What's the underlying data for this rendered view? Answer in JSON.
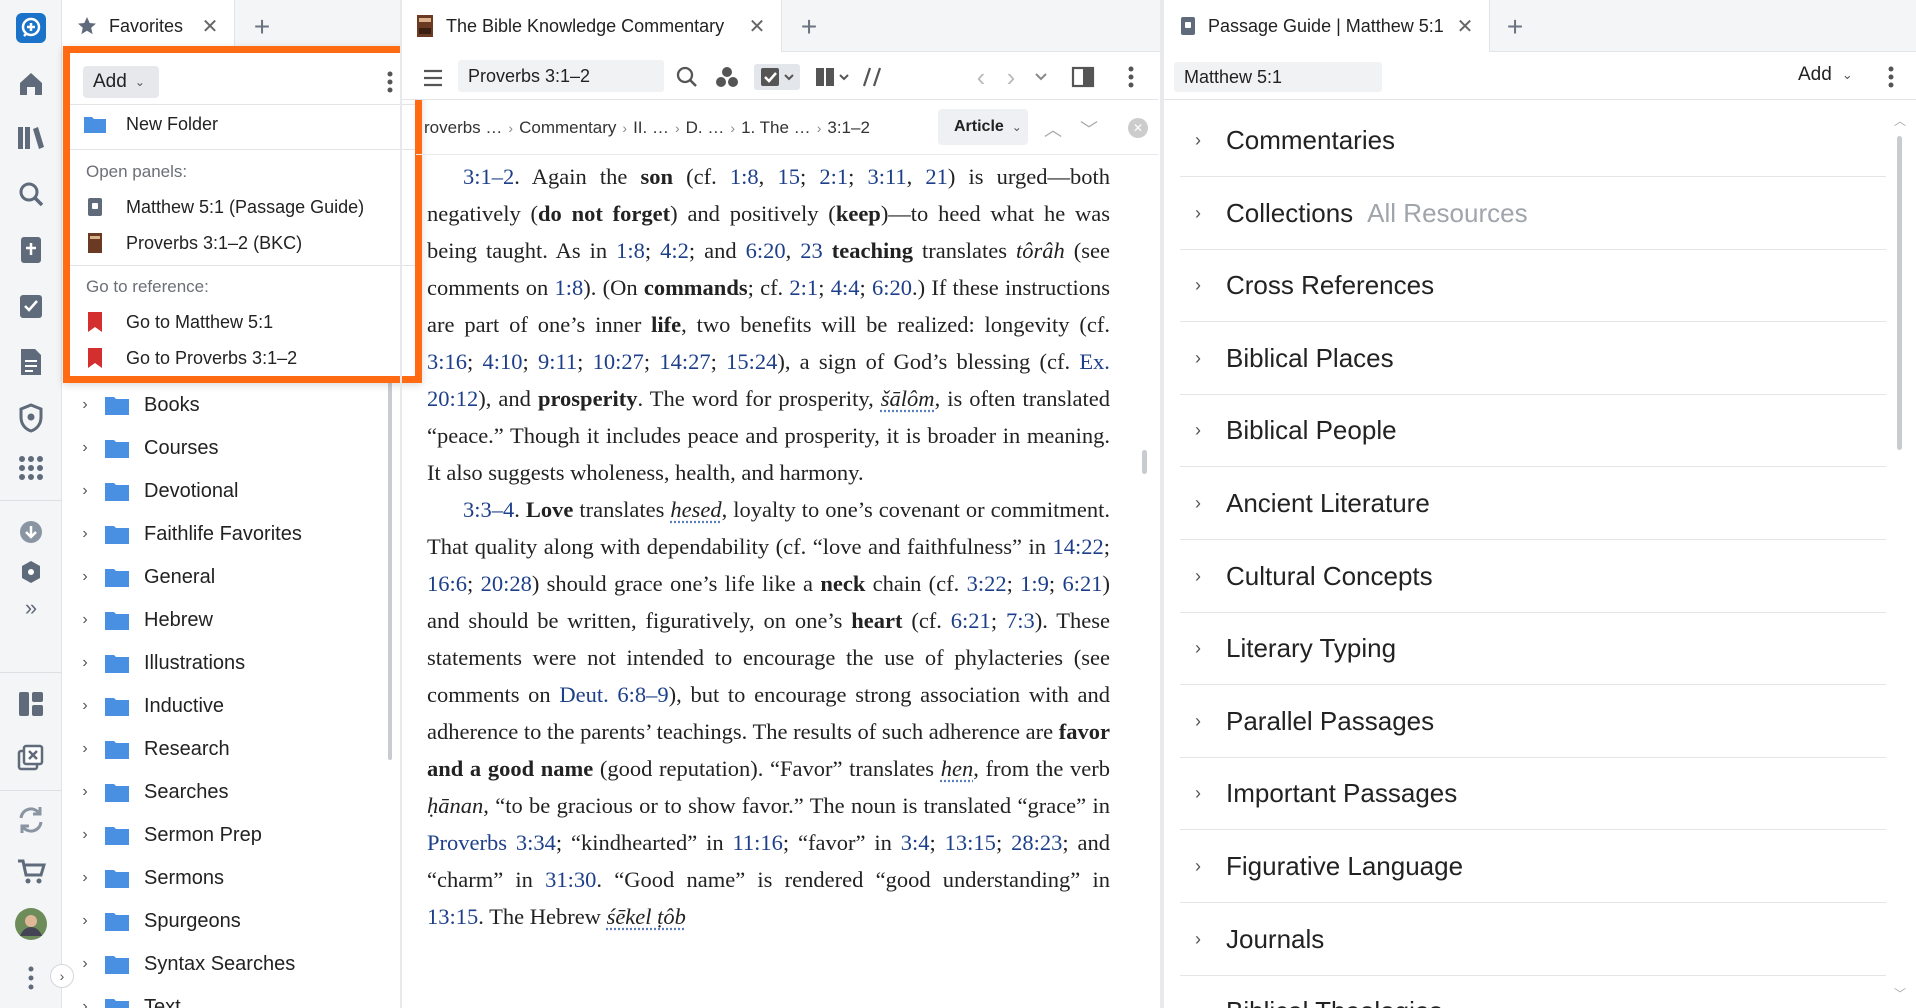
{
  "colors": {
    "accent": "#ff6a13",
    "link": "#1d3f8a",
    "folder": "#4a90e2",
    "brand": "#1a73c8"
  },
  "rail": {
    "icons": [
      "logos-add-icon",
      "home-icon",
      "library-icon",
      "search-icon",
      "guides-icon",
      "reading-plan-icon",
      "documents-icon",
      "shield-icon",
      "apps-icon",
      "download-icon",
      "factbook-icon",
      "expand-icon",
      "layouts-icon",
      "close-panels-icon",
      "sync-icon",
      "cart-icon",
      "avatar",
      "more-icon"
    ]
  },
  "favorites": {
    "tab_title": "Favorites",
    "folders": [
      "Books",
      "Courses",
      "Devotional",
      "Faithlife Favorites",
      "General",
      "Hebrew",
      "Illustrations",
      "Inductive",
      "Research",
      "Searches",
      "Sermon Prep",
      "Sermons",
      "Spurgeons",
      "Syntax Searches",
      "Text"
    ]
  },
  "popup": {
    "add_label": "Add",
    "new_folder": "New Folder",
    "open_panels_label": "Open panels:",
    "open_panels": [
      "Matthew 5:1 (Passage Guide)",
      "Proverbs 3:1–2 (BKC)"
    ],
    "go_to_label": "Go to reference:",
    "go_to": [
      "Go to Matthew 5:1",
      "Go to Proverbs 3:1–2"
    ]
  },
  "commentary": {
    "tab_title": "The Bible Knowledge Commentary",
    "reference": "Proverbs 3:1–2",
    "breadcrumb": [
      "roverbs …",
      "Commentary",
      "II. …",
      "D. …",
      "1. The …",
      "3:1–2"
    ],
    "view_mode": "Article"
  },
  "guide": {
    "tab_title": "Passage Guide | Matthew 5:1",
    "reference": "Matthew 5:1",
    "add_label": "Add",
    "sections": [
      {
        "label": "Commentaries",
        "sub": ""
      },
      {
        "label": "Collections",
        "sub": "All Resources"
      },
      {
        "label": "Cross References",
        "sub": ""
      },
      {
        "label": "Biblical Places",
        "sub": ""
      },
      {
        "label": "Biblical People",
        "sub": ""
      },
      {
        "label": "Ancient Literature",
        "sub": ""
      },
      {
        "label": "Cultural Concepts",
        "sub": ""
      },
      {
        "label": "Literary Typing",
        "sub": ""
      },
      {
        "label": "Parallel Passages",
        "sub": ""
      },
      {
        "label": "Important Passages",
        "sub": ""
      },
      {
        "label": "Figurative Language",
        "sub": ""
      },
      {
        "label": "Journals",
        "sub": ""
      },
      {
        "label": "Biblical Theologies",
        "sub": ""
      }
    ]
  }
}
